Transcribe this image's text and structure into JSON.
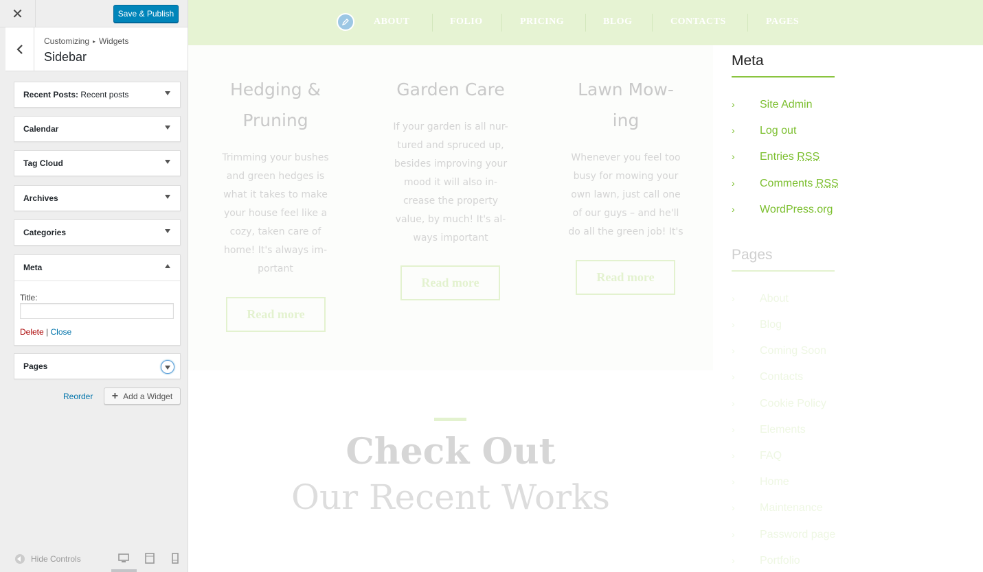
{
  "customizer": {
    "close_icon": "close-icon",
    "save_publish": "Save & Publish",
    "breadcrumb": {
      "part1": "Customizing",
      "separator": "▸",
      "part2": "Widgets"
    },
    "section_title": "Sidebar",
    "widgets": [
      {
        "label": "Recent Posts:",
        "sublabel": "Recent posts"
      },
      {
        "label": "Calendar"
      },
      {
        "label": "Tag Cloud"
      },
      {
        "label": "Archives"
      },
      {
        "label": "Categories"
      }
    ],
    "meta_widget": {
      "label": "Meta",
      "title_label": "Title:",
      "title_value": "",
      "delete": "Delete",
      "separator": "|",
      "close": "Close"
    },
    "pages_widget": {
      "label": "Pages"
    },
    "reorder": "Reorder",
    "add_widget": "Add a Widget",
    "hide_controls": "Hide Controls",
    "colors": {
      "primary_button": "#0085ba",
      "link": "#0073aa",
      "delete": "#aa0000"
    }
  },
  "preview": {
    "nav": [
      "ABOUT",
      "FOLIO",
      "PRICING",
      "BLOG",
      "CONTACTS",
      "PAGES"
    ],
    "services": [
      {
        "title_lines": [
          "Hedging &",
          "Pruning"
        ],
        "text_lines": [
          "Trimming your bushes",
          "and green hedges is",
          "what it takes to make",
          "your house feel like a",
          "cozy, taken care of",
          "home! It's always im-",
          "portant"
        ],
        "button": "Read more"
      },
      {
        "title_lines": [
          "Garden Care"
        ],
        "text_lines": [
          "If your garden is all nur-",
          "tured and spruced up,",
          "besides improving your",
          "mood it will also in-",
          "crease the property",
          "value, by much! It's al-",
          "ways important"
        ],
        "button": "Read more"
      },
      {
        "title_lines": [
          "Lawn Mow-",
          "ing"
        ],
        "text_lines": [
          "Whenever you feel too",
          "busy for mowing your",
          "own lawn, just call one",
          "of our guys – and he'll",
          "do all the green job! It's"
        ],
        "button": "Read more"
      }
    ],
    "heading_bold": "Check Out",
    "heading_light": "Our Recent Works",
    "meta": {
      "heading": "Meta",
      "links": [
        "Site Admin",
        "Log out",
        "Entries",
        "Comments",
        "WordPress.org"
      ],
      "rss": "RSS"
    },
    "pages": {
      "heading": "Pages",
      "links": [
        "About",
        "Blog",
        "Coming Soon",
        "Contacts",
        "Cookie Policy",
        "Elements",
        "FAQ",
        "Home",
        "Maintenance",
        "Password page",
        "Portfolio"
      ]
    },
    "colors": {
      "nav_bg": "#e6f3d3",
      "accent_green": "#8ac43f",
      "link_green": "#7cbf2f"
    }
  }
}
